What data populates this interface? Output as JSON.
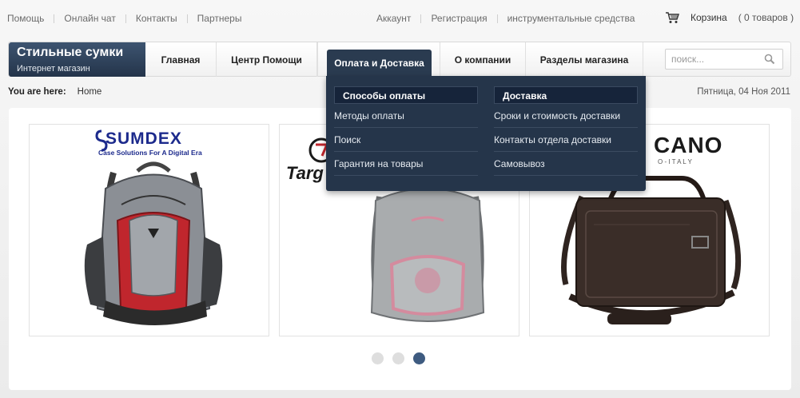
{
  "top_links_left": [
    "Помощь",
    "Онлайн чат",
    "Контакты",
    "Партнеры"
  ],
  "top_links_right": [
    "Аккаунт",
    "Регистрация",
    "инструментальные средства"
  ],
  "cart": {
    "label": "Корзина",
    "count": "( 0 товаров )"
  },
  "logo": {
    "title": "Стильные сумки",
    "subtitle": "Интернет магазин"
  },
  "nav": [
    "Главная",
    "Центр Помощи",
    "Оплата и Доставка",
    "О компании",
    "Разделы магазина"
  ],
  "search": {
    "placeholder": "поиск..."
  },
  "breadcrumb": {
    "label": "You are here:",
    "home": "Home"
  },
  "date": "Пятница, 04 Ноя 2011",
  "dropdown": {
    "col1": {
      "title": "Способы оплаты",
      "items": [
        "Методы оплаты",
        "Поиск",
        "Гарантия на товары"
      ]
    },
    "col2": {
      "title": "Доставка",
      "items": [
        "Сроки и стоимость доставки",
        "Контакты отдела доставки",
        "Самовывоз"
      ]
    }
  },
  "products": {
    "brand1": "SUMDEX",
    "brand1_tagline": "Case Solutions For A Digital Era",
    "brand2": "Targ",
    "brand3": "CANO",
    "brand3_tagline": "O - I T A L Y"
  },
  "carousel": {
    "count": 3,
    "active_index": 2
  },
  "colors": {
    "nav_dark": "#25354a",
    "accent": "#3e5b80"
  }
}
